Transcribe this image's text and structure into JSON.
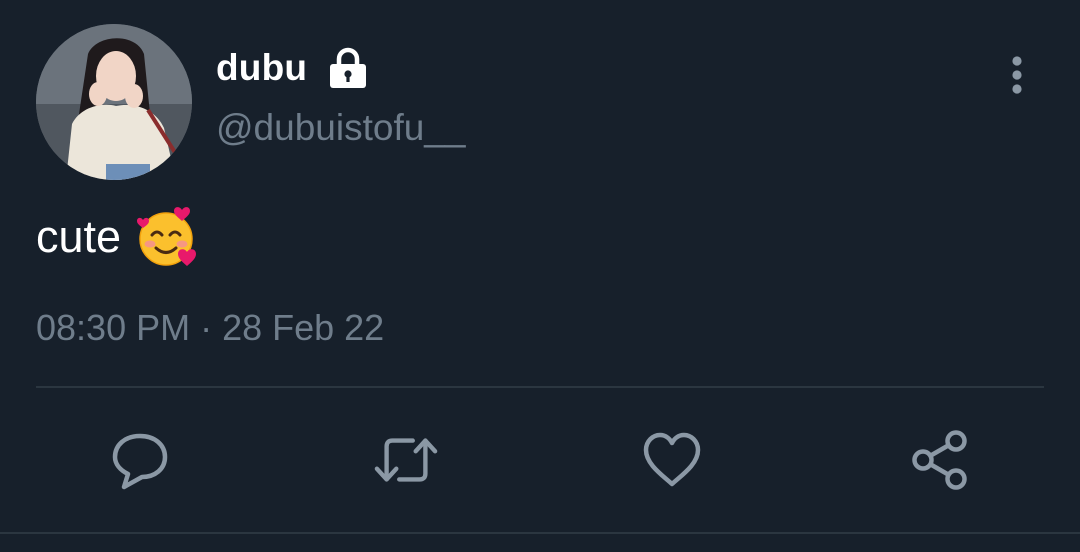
{
  "tweet": {
    "display_name": "dubu",
    "handle": "@dubuistofu__",
    "text": "cute",
    "timestamp": "08:30 PM · 28 Feb 22",
    "emoji": "smiling-face-with-hearts",
    "account_protected": true
  },
  "icons": {
    "lock": "lock-icon",
    "more": "more-vertical-icon",
    "reply": "reply-icon",
    "retweet": "retweet-icon",
    "like": "heart-icon",
    "share": "share-icon"
  },
  "colors": {
    "background": "#17202b",
    "primary_text": "#ffffff",
    "secondary_text": "#6f7d8b",
    "divider": "#2b3640"
  }
}
